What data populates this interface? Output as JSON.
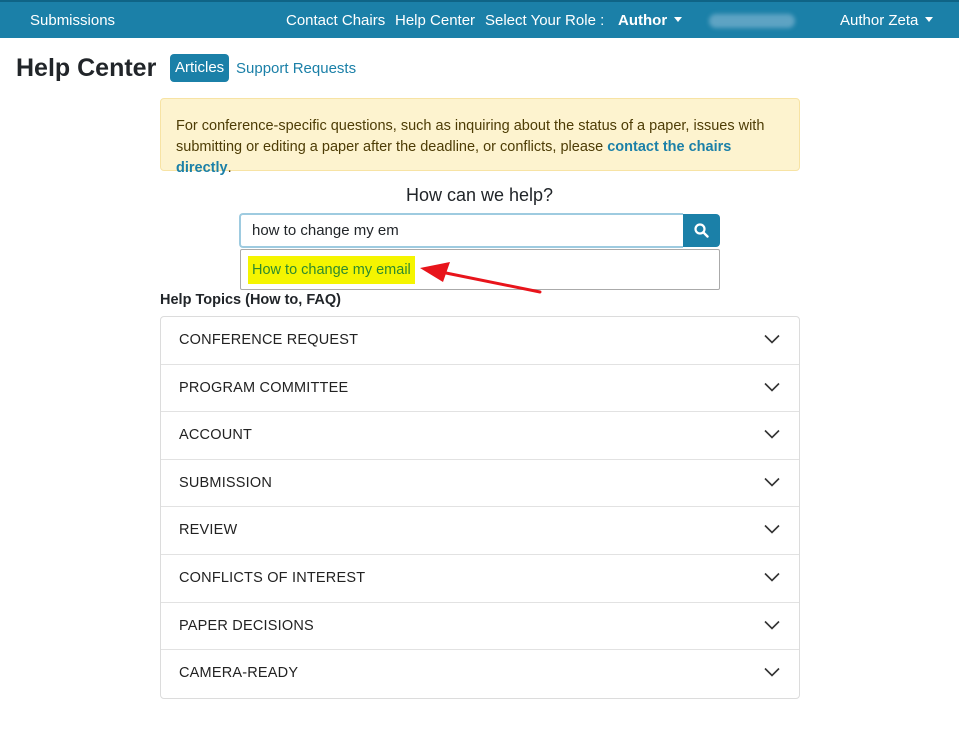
{
  "nav": {
    "submissions": "Submissions",
    "contact_chairs": "Contact Chairs",
    "help_center": "Help Center",
    "select_role_label": "Select Your Role :",
    "role": "Author",
    "user_name": "Author Zeta"
  },
  "header": {
    "title": "Help Center",
    "tab_articles": "Articles",
    "tab_support": "Support Requests"
  },
  "alert": {
    "text": "For conference-specific questions, such as inquiring about the status of a paper, issues with submitting or editing a paper after the deadline, or conflicts, please ",
    "link": "contact the chairs directly",
    "suffix": "."
  },
  "search": {
    "heading": "How can we help?",
    "value": "how to change my em",
    "suggestion": "How to change my email"
  },
  "topics": {
    "heading": "Help Topics (How to, FAQ)",
    "items": [
      "CONFERENCE REQUEST",
      "PROGRAM COMMITTEE",
      "ACCOUNT",
      "SUBMISSION",
      "REVIEW",
      "CONFLICTS OF INTEREST",
      "PAPER DECISIONS",
      "CAMERA-READY"
    ]
  },
  "colors": {
    "primary": "#1b80a8",
    "alert_bg": "#fdf3cf",
    "highlight": "#f5f500",
    "arrow": "#e8141b"
  }
}
